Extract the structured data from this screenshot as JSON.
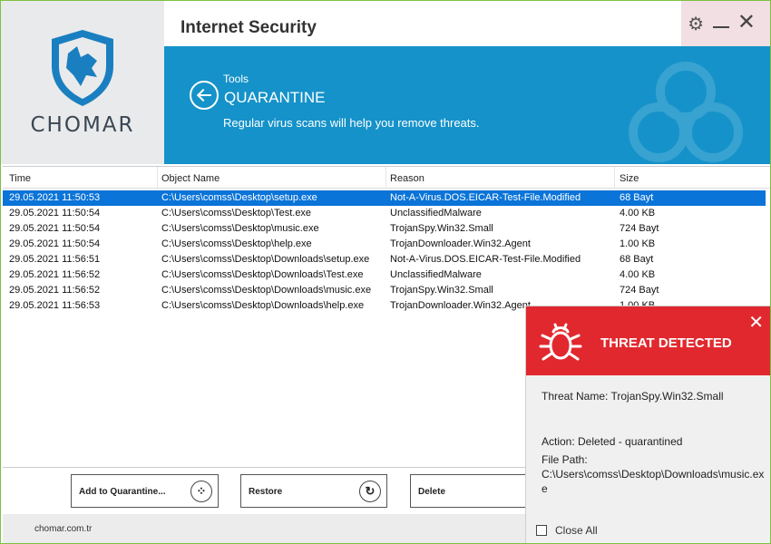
{
  "app": {
    "brand": "CHOMAR",
    "title": "Internet Security"
  },
  "banner": {
    "crumb": "Tools",
    "section": "QUARANTINE",
    "subtitle": "Regular virus scans will help you remove threats."
  },
  "table": {
    "headers": [
      "Time",
      "Object Name",
      "Reason",
      "Size"
    ],
    "rows": [
      {
        "time": "29.05.2021 11:50:53",
        "object": "C:\\Users\\comss\\Desktop\\setup.exe",
        "reason": "Not-A-Virus.DOS.EICAR-Test-File.Modified",
        "size": "68 Bayt"
      },
      {
        "time": "29.05.2021 11:50:54",
        "object": "C:\\Users\\comss\\Desktop\\Test.exe",
        "reason": "UnclassifiedMalware",
        "size": "4.00 KB"
      },
      {
        "time": "29.05.2021 11:50:54",
        "object": "C:\\Users\\comss\\Desktop\\music.exe",
        "reason": "TrojanSpy.Win32.Small",
        "size": "724 Bayt"
      },
      {
        "time": "29.05.2021 11:50:54",
        "object": "C:\\Users\\comss\\Desktop\\help.exe",
        "reason": "TrojanDownloader.Win32.Agent",
        "size": "1.00 KB"
      },
      {
        "time": "29.05.2021 11:56:51",
        "object": "C:\\Users\\comss\\Desktop\\Downloads\\setup.exe",
        "reason": "Not-A-Virus.DOS.EICAR-Test-File.Modified",
        "size": "68 Bayt"
      },
      {
        "time": "29.05.2021 11:56:52",
        "object": "C:\\Users\\comss\\Desktop\\Downloads\\Test.exe",
        "reason": "UnclassifiedMalware",
        "size": "4.00 KB"
      },
      {
        "time": "29.05.2021 11:56:52",
        "object": "C:\\Users\\comss\\Desktop\\Downloads\\music.exe",
        "reason": "TrojanSpy.Win32.Small",
        "size": "724 Bayt"
      },
      {
        "time": "29.05.2021 11:56:53",
        "object": "C:\\Users\\comss\\Desktop\\Downloads\\help.exe",
        "reason": "TrojanDownloader.Win32.Agent",
        "size": "1.00 KB"
      }
    ]
  },
  "toolbar": {
    "add_label": "Add to Quarantine...",
    "restore_label": "Restore",
    "delete_label": "Delete"
  },
  "footer": {
    "url": "chomar.com.tr"
  },
  "popup": {
    "title": "THREAT DETECTED",
    "threat_name": "Threat Name: TrojanSpy.Win32.Small",
    "action": "Action: Deleted - quarantined",
    "file_path_label": "File Path:",
    "file_path_line1": "C:\\Users\\comss\\Desktop\\Downloads\\music.ex",
    "file_path_line2": "e",
    "close_all": "Close All"
  },
  "colors": {
    "accent": "#1592c9",
    "selected_row": "#0a74d8",
    "alert": "#e1282e",
    "window_border": "#7cc142"
  },
  "icons": [
    "chomar-shield-logo",
    "gear-icon",
    "minimize-icon",
    "close-icon",
    "back-arrow-icon",
    "biohazard-icon",
    "bug-icon",
    "restore-icon"
  ]
}
